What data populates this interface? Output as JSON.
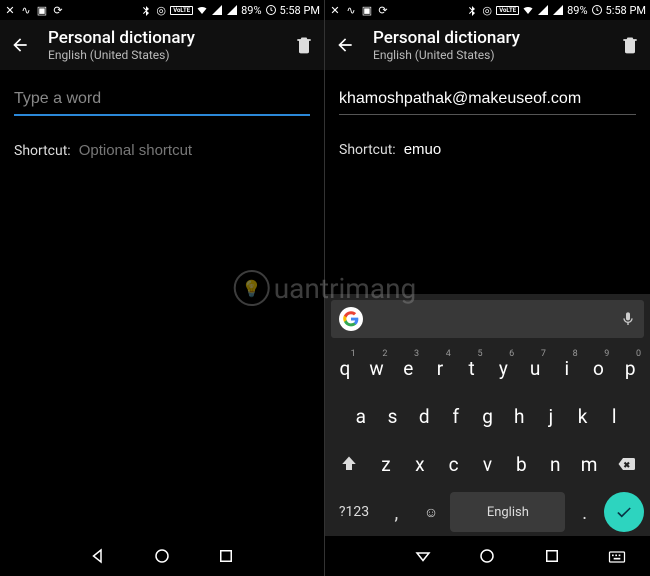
{
  "statusbar": {
    "battery": "89%",
    "time": "5:58 PM",
    "volte": "VoLTE"
  },
  "toolbar": {
    "title": "Personal dictionary",
    "subtitle": "English (United States)"
  },
  "left": {
    "word_placeholder": "Type a word",
    "word_value": "",
    "shortcut_label": "Shortcut:",
    "shortcut_placeholder": "Optional shortcut",
    "shortcut_value": ""
  },
  "right": {
    "word_value": "khamoshpathak@makeuseof.com",
    "shortcut_label": "Shortcut:",
    "shortcut_value": "emuo"
  },
  "keyboard": {
    "row1": [
      {
        "k": "q",
        "h": "1"
      },
      {
        "k": "w",
        "h": "2"
      },
      {
        "k": "e",
        "h": "3"
      },
      {
        "k": "r",
        "h": "4"
      },
      {
        "k": "t",
        "h": "5"
      },
      {
        "k": "y",
        "h": "6"
      },
      {
        "k": "u",
        "h": "7"
      },
      {
        "k": "i",
        "h": "8"
      },
      {
        "k": "o",
        "h": "9"
      },
      {
        "k": "p",
        "h": "0"
      }
    ],
    "row2": [
      "a",
      "s",
      "d",
      "f",
      "g",
      "h",
      "j",
      "k",
      "l"
    ],
    "row3": [
      "z",
      "x",
      "c",
      "v",
      "b",
      "n",
      "m"
    ],
    "sym_label": "?123",
    "space_label": "English",
    "comma": ",",
    "period": "."
  },
  "watermark": "uantrimang"
}
